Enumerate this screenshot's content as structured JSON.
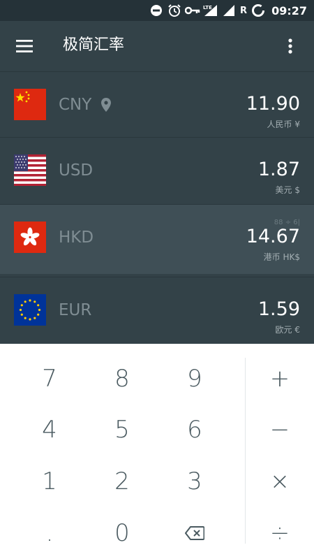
{
  "status_bar": {
    "time": "09:27",
    "roaming": "R",
    "network": "LTE"
  },
  "app": {
    "title": "极简汇率"
  },
  "currencies": [
    {
      "code": "CNY",
      "name": "人民币 ¥",
      "amount": "11.90",
      "flag": "cn-flag",
      "location": true
    },
    {
      "code": "USD",
      "name": "美元 $",
      "amount": "1.87",
      "flag": "us-flag"
    },
    {
      "code": "HKD",
      "name": "港币 HK$",
      "amount": "14.67",
      "flag": "hk-flag",
      "expression": "88 ÷ 6|",
      "selected": true
    },
    {
      "code": "EUR",
      "name": "欧元 €",
      "amount": "1.59",
      "flag": "eu-flag"
    }
  ],
  "keypad": {
    "keys": [
      "7",
      "8",
      "9",
      "4",
      "5",
      "6",
      "1",
      "2",
      "3",
      ".",
      "0"
    ],
    "ops": [
      "+",
      "−",
      "×",
      "÷"
    ],
    "backspace_icon": "backspace-icon"
  },
  "colors": {
    "status_bar": "#253238",
    "app_bar": "#334248",
    "list_bg": "#334248",
    "selected_row": "#3f4f56",
    "amount_text": "#ffffff",
    "code_text": "#7f8d93"
  }
}
